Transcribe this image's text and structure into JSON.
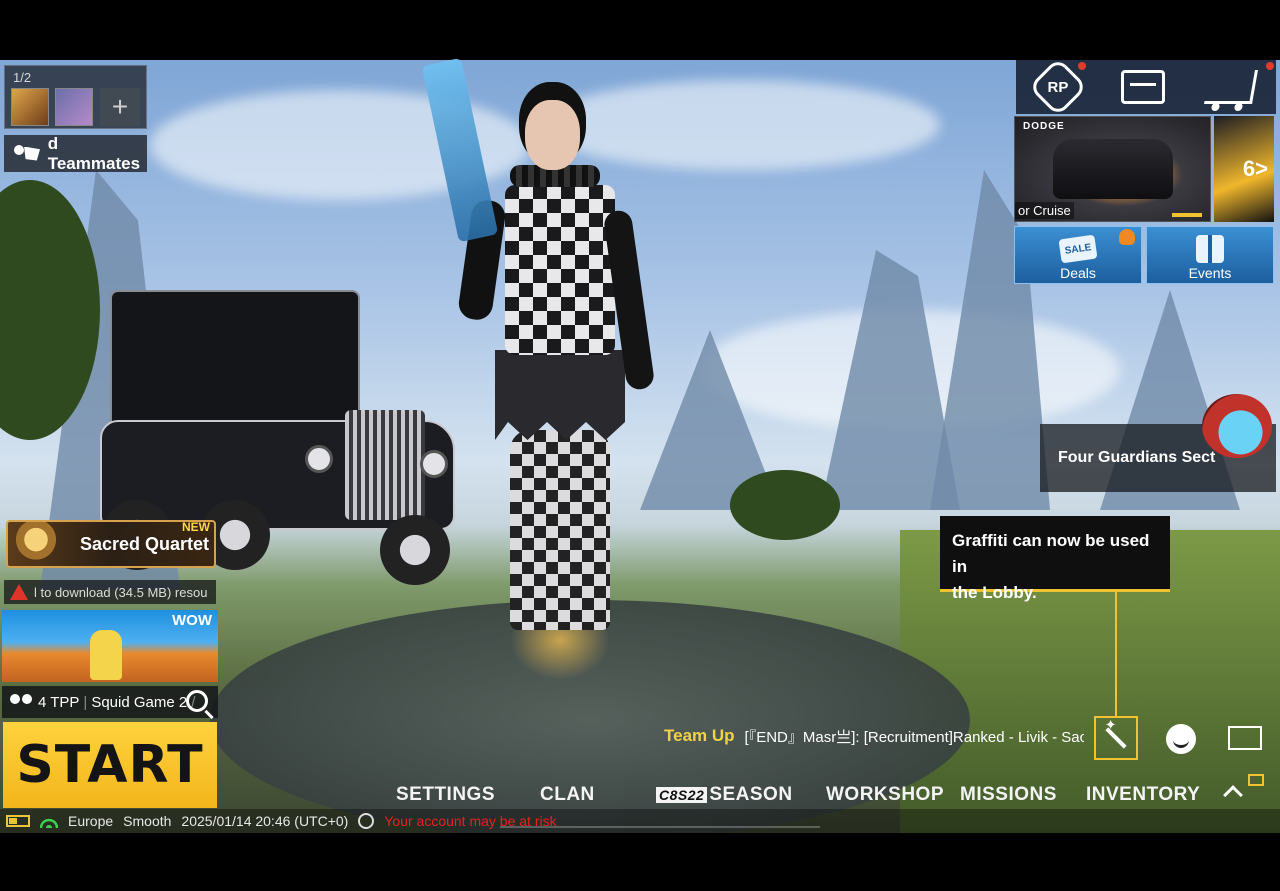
{
  "team": {
    "count": "1/2",
    "find_teammates": "d Teammates"
  },
  "event": {
    "title": "Sacred Quartet",
    "badge": "NEW"
  },
  "download": {
    "text": "l to download (34.5 MB) resou"
  },
  "mode": {
    "tag": "WOW",
    "perspective": "4 TPP",
    "separator": "|",
    "name": "Squid Game 2",
    "slash": "/"
  },
  "start": {
    "label": "START"
  },
  "status": {
    "region": "Europe",
    "quality": "Smooth",
    "datetime": "2025/01/14 20:46 (UTC+0)",
    "warning": "Your account may be at risk"
  },
  "store": {
    "rp_label": "RP"
  },
  "promo": {
    "brand": "DODGE",
    "caption": "or Cruise",
    "next_label": "6>"
  },
  "tiles": {
    "deals": "Deals",
    "events": "Events",
    "sale_tag": "SALE"
  },
  "guardians": {
    "label": "Four Guardians Sect"
  },
  "tooltip": {
    "line1": "Graffiti can now be used in",
    "line2": "the Lobby."
  },
  "chat": {
    "team_up": "Team Up",
    "message": "[『END』Masr亗]: [Recruitment]Ranked - Livik - Sacre"
  },
  "nav": {
    "settings": "SETTINGS",
    "clan": "CLAN",
    "season_badge": "C8S22",
    "season": "SEASON",
    "workshop": "WORKSHOP",
    "missions": "MISSIONS",
    "inventory": "INVENTORY"
  },
  "colors": {
    "accent": "#f1c232",
    "start": "#ffd23d",
    "warning": "#e2241c",
    "team_up": "#f1d24a"
  },
  "icons": [
    "people-icon",
    "trophy-icon",
    "warn-icon",
    "squad-icon",
    "search-icon",
    "battery-icon",
    "wifi-icon",
    "rp-icon",
    "crate-icon",
    "cart-icon",
    "sale-icon",
    "gift-icon",
    "helmet-icon",
    "wand-icon",
    "emote-icon",
    "fullscreen-icon",
    "chevron-up-icon",
    "mail-icon"
  ]
}
